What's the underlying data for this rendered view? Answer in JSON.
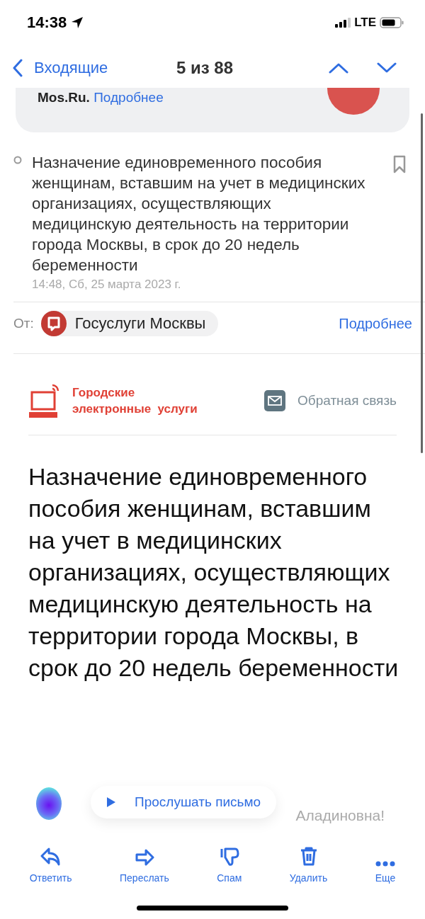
{
  "status_bar": {
    "time": "14:38",
    "network": "LTE"
  },
  "nav": {
    "back": "Входящие",
    "counter": "5 из 88"
  },
  "banner": {
    "source": "Mos.Ru.",
    "link": "Подробнее"
  },
  "message": {
    "subject": "Назначение единовременного пособия женщинам, вставшим на учет в медицинских организациях, осуществляющих медицинскую деятельность на территории города Москвы, в срок до 20 недель беременности",
    "date": "14:48, Сб, 25 марта 2023 г.",
    "bookmarked": false,
    "from_label": "От:",
    "sender": "Госуслуги Москвы",
    "details": "Подробнее"
  },
  "body": {
    "logo_line_1": "Городские",
    "logo_line_2": "электронные  услуги",
    "feedback": "Обратная связь",
    "heading": "Назначение единовременного пособия женщинам, вставшим на учет в медицинских организациях, осуществляющих медицинскую деятельность на территории города Москвы, в срок до 20 недель беременности",
    "greeting": "Аладиновна!"
  },
  "listen_button": "Прослушать письмо",
  "toolbar": [
    {
      "kind": "reply",
      "label": "Ответить"
    },
    {
      "kind": "forward",
      "label": "Переслать"
    },
    {
      "kind": "spam",
      "label": "Спам"
    },
    {
      "kind": "delete",
      "label": "Удалить"
    },
    {
      "kind": "more",
      "label": "Еще"
    }
  ]
}
